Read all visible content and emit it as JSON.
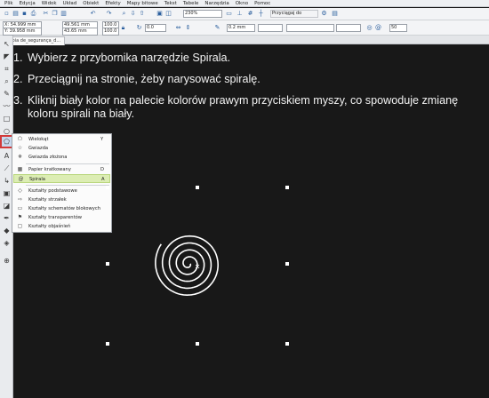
{
  "menubar": {
    "items": [
      "Plik",
      "Edycja",
      "Widok",
      "Układ",
      "Obiekt",
      "Efekty",
      "Mapy bitowe",
      "Tekst",
      "Tabele",
      "Narzędzia",
      "Okno",
      "Pomoc"
    ]
  },
  "toolbar": {
    "zoom": "230%",
    "snap_label": "Przyciągaj do",
    "pos_x": "X: 54.999 mm",
    "pos_y": "Y: 39.958 mm",
    "width": "49.561 mm",
    "height": "43.65 mm",
    "scale_w": "100.0",
    "scale_h": "100.0",
    "angle": "0.0",
    "outline_width": "0.2 mm",
    "revolutions": "50"
  },
  "document_tab": "Cópia de_segurança_d...",
  "instructions": [
    "Wybierz z przybornika narzędzie Spirala.",
    "Przeciągnij na stronie, żeby narysować spiralę.",
    "Kliknij biały kolor na palecie kolorów prawym przyciskiem myszy, co spowoduje zmianę koloru spirali na biały."
  ],
  "flyout": {
    "items": [
      {
        "icon": "polygon-icon",
        "glyph": "⬠",
        "label": "Wielokąt",
        "shortcut": "Y",
        "selected": false
      },
      {
        "icon": "star-icon",
        "glyph": "☆",
        "label": "Gwiazda",
        "shortcut": "",
        "selected": false
      },
      {
        "icon": "complex-star-icon",
        "glyph": "✵",
        "label": "Gwiazda złożona",
        "shortcut": "",
        "selected": false
      },
      {
        "icon": "graph-paper-icon",
        "glyph": "▦",
        "label": "Papier kratkowany",
        "shortcut": "D",
        "selected": false
      },
      {
        "icon": "spiral-icon",
        "glyph": "@",
        "label": "Spirala",
        "shortcut": "A",
        "selected": true
      },
      {
        "icon": "basic-shapes-icon",
        "glyph": "◇",
        "label": "Kształty podstawowe",
        "shortcut": "",
        "selected": false
      },
      {
        "icon": "arrow-shapes-icon",
        "glyph": "⇨",
        "label": "Kształty strzałek",
        "shortcut": "",
        "selected": false
      },
      {
        "icon": "flowchart-shapes-icon",
        "glyph": "▭",
        "label": "Kształty schematów blokowych",
        "shortcut": "",
        "selected": false
      },
      {
        "icon": "banner-shapes-icon",
        "glyph": "⚑",
        "label": "Kształty transparentów",
        "shortcut": "",
        "selected": false
      },
      {
        "icon": "callout-shapes-icon",
        "glyph": "▢",
        "label": "Kształty objaśnień",
        "shortcut": "",
        "selected": false
      }
    ]
  },
  "colors": {
    "canvas": "#181818",
    "spiral": "#ffffff",
    "selected_item": "#dcedb3",
    "active_tool_outline": "#d23a3a"
  }
}
